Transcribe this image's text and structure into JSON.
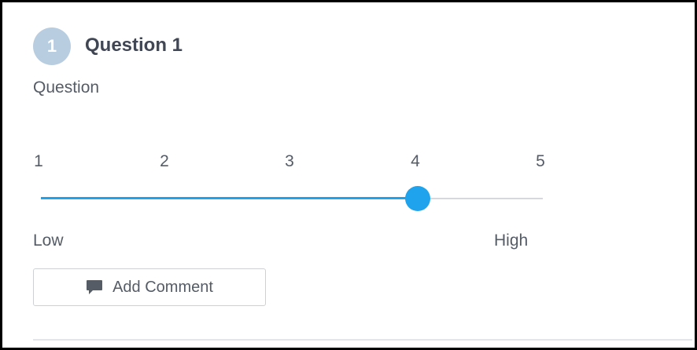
{
  "question": {
    "number": "1",
    "title": "Question 1",
    "text": "Question"
  },
  "scale": {
    "values": [
      "1",
      "2",
      "3",
      "4",
      "5"
    ],
    "selected": 4,
    "min": 1,
    "max": 5,
    "low_label": "Low",
    "high_label": "High"
  },
  "actions": {
    "add_comment_label": "Add Comment",
    "comment_icon": "comment-icon"
  },
  "colors": {
    "accent": "#1fa3ec",
    "badge": "#b8cde0",
    "track": "#d5d8dc",
    "text": "#555c66",
    "title": "#404654"
  }
}
